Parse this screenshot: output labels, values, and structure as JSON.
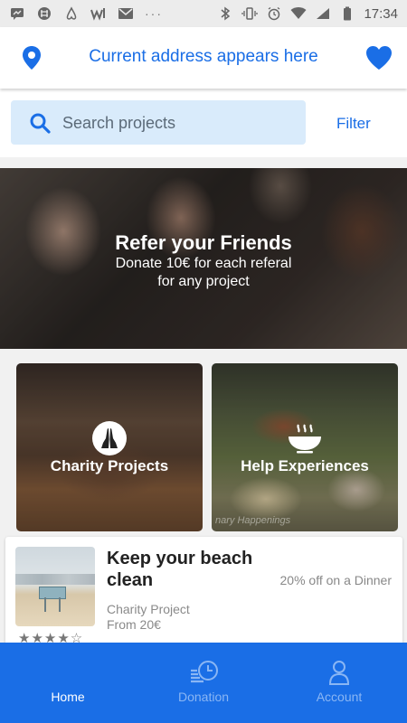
{
  "status_bar": {
    "time": "17:34",
    "left_icons": [
      "messages-icon",
      "slack-icon",
      "airbnb-icon",
      "wish-icon",
      "gmail-icon",
      "more-dots-icon"
    ],
    "right_icons": [
      "bluetooth-icon",
      "vibrate-icon",
      "alarm-icon",
      "wifi-icon",
      "signal-icon",
      "battery-icon"
    ],
    "more": "···"
  },
  "header": {
    "address": "Current address appears here",
    "accent_color": "#1a6ee6"
  },
  "search": {
    "placeholder": "Search projects",
    "filter_label": "Filter"
  },
  "banner": {
    "title": "Refer your Friends",
    "line1": "Donate 10€ for each referal",
    "line2": "for any project"
  },
  "categories": [
    {
      "label": "Charity Projects",
      "icon": "praying-hands-icon"
    },
    {
      "label": "Help Experiences",
      "icon": "hot-food-bowl-icon",
      "watermark": "nary Happenings"
    }
  ],
  "project_card": {
    "title": "Keep your beach clean",
    "deal": "20% off on a Dinner",
    "type": "Charity Project",
    "price": "From 20€",
    "rating": 4,
    "rating_max": 5,
    "stars_text": "★★★★☆"
  },
  "bottom_nav": {
    "items": [
      {
        "label": "Home",
        "active": true
      },
      {
        "label": "Donation",
        "active": false,
        "icon": "donation-clock-icon"
      },
      {
        "label": "Account",
        "active": false,
        "icon": "account-person-icon"
      }
    ]
  }
}
